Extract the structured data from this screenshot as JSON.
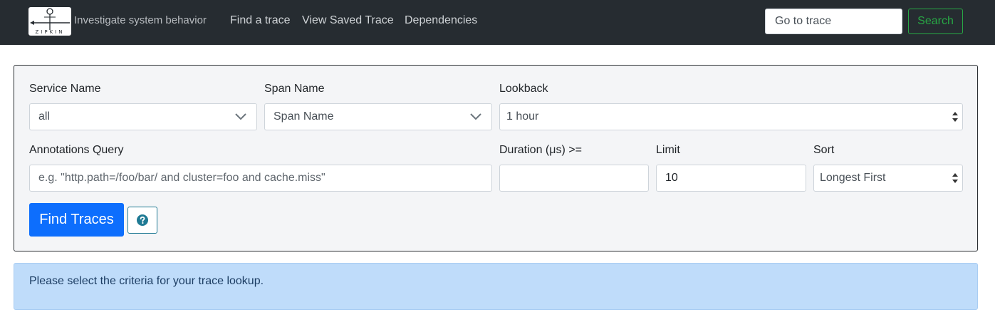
{
  "navbar": {
    "logo_text": "ZIPKIN",
    "tagline": "Investigate system behavior",
    "links": [
      "Find a trace",
      "View Saved Trace",
      "Dependencies"
    ],
    "goto_placeholder": "Go to trace",
    "search_label": "Search"
  },
  "form": {
    "service_name": {
      "label": "Service Name",
      "value": "all",
      "icon": "chevron-down-icon"
    },
    "span_name": {
      "label": "Span Name",
      "value": "Span Name",
      "icon": "chevron-down-icon"
    },
    "lookback": {
      "label": "Lookback",
      "value": "1 hour",
      "icon": "select-arrows-icon"
    },
    "annotations": {
      "label": "Annotations Query",
      "placeholder": "e.g. \"http.path=/foo/bar/ and cluster=foo and cache.miss\""
    },
    "duration": {
      "label": "Duration (μs) >=",
      "value": ""
    },
    "limit": {
      "label": "Limit",
      "value": "10"
    },
    "sort": {
      "label": "Sort",
      "value": "Longest First",
      "icon": "select-arrows-icon"
    },
    "find_label": "Find Traces",
    "help_icon": "question-circle-icon"
  },
  "alert": {
    "message": "Please select the criteria for your trace lookup."
  },
  "colors": {
    "navbar_bg": "#262c31",
    "primary": "#0d6efd",
    "success": "#28a745",
    "info": "#1f7a94",
    "alert_bg": "#bfdcfa"
  }
}
